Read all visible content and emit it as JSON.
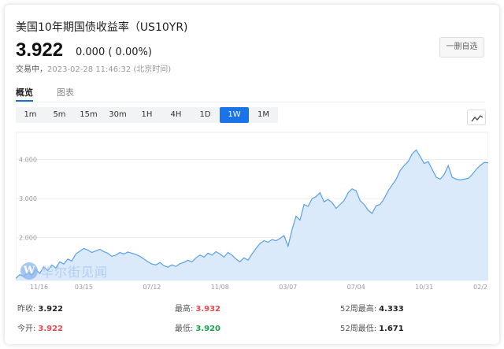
{
  "header": {
    "title": "美国10年期国债收益率（US10YR)",
    "price": "3.922",
    "change": "0.000 ( 0.00%)",
    "status_label": "交易中，",
    "status_time": "2023-02-28 11:46:32 (北京时间)",
    "watch_button": "一删自选"
  },
  "view_tabs": [
    {
      "label": "概览",
      "active": true
    },
    {
      "label": "图表",
      "active": false
    }
  ],
  "periods": [
    {
      "label": "1m",
      "active": false
    },
    {
      "label": "5m",
      "active": false
    },
    {
      "label": "15m",
      "active": false
    },
    {
      "label": "30m",
      "active": false
    },
    {
      "label": "1H",
      "active": false
    },
    {
      "label": "4H",
      "active": false
    },
    {
      "label": "1D",
      "active": false
    },
    {
      "label": "1W",
      "active": true
    },
    {
      "label": "1M",
      "active": false
    }
  ],
  "chart_type_icon": "line-chart-icon",
  "watermark": {
    "logo": "W",
    "text": "华尔街见闻"
  },
  "stats": {
    "prev_close": {
      "label": "昨收:",
      "value": "3.922"
    },
    "open": {
      "label": "今开:",
      "value": "3.922"
    },
    "high": {
      "label": "最高:",
      "value": "3.932"
    },
    "low": {
      "label": "最低:",
      "value": "3.920"
    },
    "high_52w": {
      "label": "52周最高:",
      "value": "4.333"
    },
    "low_52w": {
      "label": "52周最低:",
      "value": "1.671"
    }
  },
  "colors": {
    "accent": "#1a73e8",
    "line": "#5aa1ea",
    "area": "#dbeafb",
    "up": "#e5484d",
    "down": "#17a34a"
  },
  "chart_data": {
    "type": "area",
    "title": "",
    "xlabel": "",
    "ylabel": "",
    "ylim": [
      0.9,
      4.7
    ],
    "y_ticks": [
      "4.000",
      "3.000",
      "2.000"
    ],
    "y_tick_values": [
      4.0,
      3.0,
      2.0
    ],
    "x_ticks": [
      "11/16",
      "03/15",
      "07/12",
      "11/08",
      "03/07",
      "07/04",
      "10/31",
      "02/2"
    ],
    "x_tick_index": [
      0,
      17,
      34,
      51,
      68,
      85,
      102,
      118
    ],
    "grid": true,
    "series": [
      {
        "values": [
          0.95,
          1.05,
          1.0,
          1.12,
          1.03,
          1.18,
          1.08,
          1.25,
          1.15,
          1.3,
          1.22,
          1.38,
          1.32,
          1.45,
          1.4,
          1.58,
          1.65,
          1.72,
          1.68,
          1.62,
          1.66,
          1.7,
          1.64,
          1.6,
          1.52,
          1.55,
          1.62,
          1.58,
          1.63,
          1.6,
          1.57,
          1.52,
          1.45,
          1.38,
          1.32,
          1.3,
          1.36,
          1.28,
          1.24,
          1.3,
          1.26,
          1.33,
          1.36,
          1.42,
          1.38,
          1.48,
          1.55,
          1.5,
          1.6,
          1.55,
          1.64,
          1.58,
          1.5,
          1.62,
          1.55,
          1.45,
          1.38,
          1.48,
          1.42,
          1.58,
          1.72,
          1.85,
          1.92,
          1.88,
          1.95,
          1.92,
          1.98,
          2.05,
          1.78,
          2.2,
          2.55,
          2.45,
          2.85,
          2.8,
          3.0,
          3.05,
          3.15,
          2.92,
          2.98,
          2.9,
          2.75,
          2.85,
          2.95,
          3.15,
          3.25,
          3.2,
          2.95,
          2.85,
          2.7,
          2.62,
          2.82,
          2.85,
          3.0,
          3.2,
          3.35,
          3.5,
          3.72,
          3.85,
          3.95,
          4.15,
          4.25,
          4.08,
          3.9,
          3.95,
          3.75,
          3.55,
          3.5,
          3.62,
          3.85,
          3.55,
          3.5,
          3.48,
          3.5,
          3.52,
          3.62,
          3.75,
          3.85,
          3.93,
          3.92
        ]
      }
    ]
  }
}
